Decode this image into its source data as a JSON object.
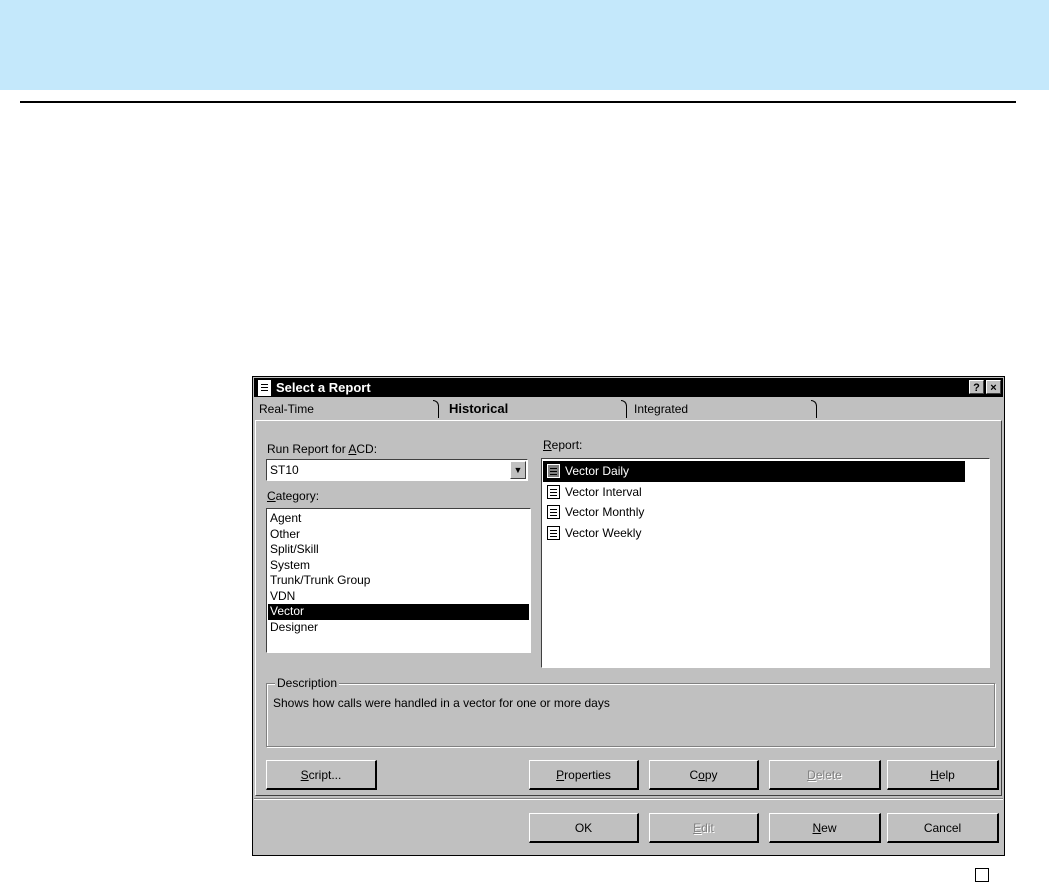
{
  "dialog": {
    "title": "Select a Report",
    "help_button": "?",
    "close_button": "×"
  },
  "tabs": [
    {
      "label": "Real-Time",
      "active": false
    },
    {
      "label": "Historical",
      "active": true
    },
    {
      "label": "Integrated",
      "active": false
    }
  ],
  "acd": {
    "label_pre": "Run Report for ",
    "label_key": "A",
    "label_post": "CD:",
    "value": "ST10"
  },
  "category": {
    "label_key": "C",
    "label_post": "ategory:",
    "items": [
      "Agent",
      "Other",
      "Split/Skill",
      "System",
      "Trunk/Trunk Group",
      "VDN",
      "Vector",
      "Designer"
    ],
    "selected": "Vector"
  },
  "report": {
    "label_key": "R",
    "label_post": "eport:",
    "items": [
      "Vector Daily",
      "Vector Interval",
      "Vector Monthly",
      "Vector Weekly"
    ],
    "selected": "Vector Daily"
  },
  "description": {
    "legend": "Description",
    "text": "Shows how calls were handled in a vector for one or more days"
  },
  "buttons": {
    "script": {
      "key": "S",
      "rest": "cript..."
    },
    "properties": {
      "key": "P",
      "rest": "roperties"
    },
    "copy": {
      "pre": "C",
      "key": "o",
      "rest": "py"
    },
    "delete": {
      "key": "D",
      "rest": "elete"
    },
    "help": {
      "key": "H",
      "rest": "elp"
    },
    "ok": "OK",
    "edit": {
      "key": "E",
      "rest": "dit"
    },
    "new": {
      "key": "N",
      "rest": "ew"
    },
    "cancel": "Cancel"
  },
  "colors": {
    "banner": "#c4e8fb",
    "dialog_face": "#c0c0c0",
    "selection": "#000000"
  }
}
